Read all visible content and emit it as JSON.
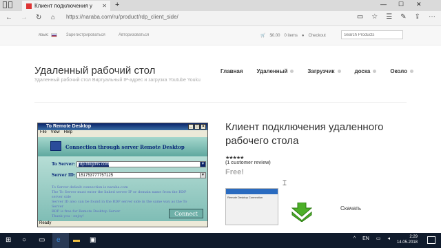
{
  "browser": {
    "tab_title": "Клиент подключения у",
    "tab_close": "✕",
    "new_tab": "+",
    "url": "https://naraba.com/ru/product/rdp_client_side/",
    "window_controls": [
      "—",
      "☐",
      "✕"
    ],
    "nav_icons": [
      "arrow-left-icon",
      "arrow-right-icon",
      "refresh-icon",
      "home-icon"
    ]
  },
  "topbar": {
    "lang_label": "язык:",
    "register": "Зарегистрироваться",
    "login": "Авторизоваться",
    "cart_total": "$0.00",
    "cart_items": "0 items",
    "checkout": "Checkout",
    "search_placeholder": "Search Products"
  },
  "site": {
    "title": "Удаленный рабочий стол",
    "description": "Удаленный рабочий стол Виртуальный IP-адрес и загрузка Youtube Youku",
    "nav": [
      "Главная",
      "Удаленный",
      "Загрузчик",
      "доска",
      "Около"
    ]
  },
  "app_window": {
    "title": "To Remote Desktop",
    "menu": [
      "File",
      "View",
      "Help"
    ],
    "banner": "Connection through server Remote Desktop",
    "to_server_label": "To Server:",
    "to_server_value": "rdp.blogdns.com",
    "server_id_label": "Server ID:",
    "server_id_value": "151753777757125",
    "notes": [
      "To Server default connection is naraba.com",
      "The To Server must enter the linked server IP or domain name from the RDP server side",
      "Server ID also can be found in the RDP server side in the same way as the To Server",
      "RDP is free for Remote Desktop Server",
      "Thank you - enjoy!"
    ],
    "connect": "Connect",
    "status": "Ready"
  },
  "product": {
    "title": "Клиент подключения удаленного рабочего стола",
    "stars": "★★★★★",
    "reviews": "(1 customer review)",
    "price": "Free!",
    "download": "Скачать",
    "thumb_title": "Remote Desktop Connection"
  },
  "taskbar": {
    "lang": "EN",
    "time": "2:29",
    "date": "14.05.2018"
  },
  "colors": {
    "app_title_bar": "#0a246a",
    "app_body": "#7fbdb5",
    "download_arrow": "#4caf28",
    "taskbar": "#101b2c"
  }
}
